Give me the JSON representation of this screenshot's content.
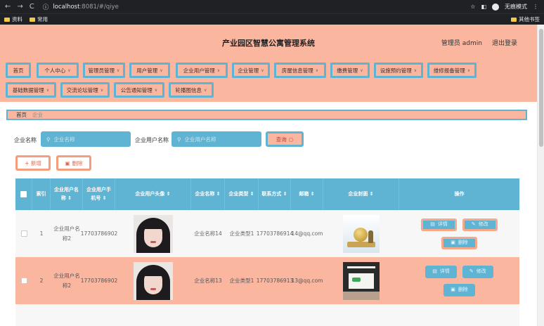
{
  "browser": {
    "url_host": "localhost",
    "url_path": ":8081/#/qiye",
    "incognito_label": "无痕模式",
    "bookmarks": [
      "资料",
      "常用"
    ],
    "other_bookmarks": "其他书签"
  },
  "header": {
    "title": "产业园区智慧公寓管理系统",
    "admin_label": "管理员 admin",
    "logout_label": "退出登录"
  },
  "menu": {
    "items": [
      {
        "label": "首页",
        "has_dropdown": false
      },
      {
        "label": "个人中心",
        "has_dropdown": true
      },
      {
        "label": "管理员管理",
        "has_dropdown": true
      },
      {
        "label": "用户管理",
        "has_dropdown": true
      },
      {
        "label": "企业用户管理",
        "has_dropdown": true
      },
      {
        "label": "企业管理",
        "has_dropdown": true
      },
      {
        "label": "房屋信息管理",
        "has_dropdown": true
      },
      {
        "label": "缴费管理",
        "has_dropdown": true
      },
      {
        "label": "设施预约管理",
        "has_dropdown": true
      },
      {
        "label": "维修报备管理",
        "has_dropdown": true
      },
      {
        "label": "基础数据管理",
        "has_dropdown": true
      },
      {
        "label": "交流论坛管理",
        "has_dropdown": true
      },
      {
        "label": "公告通知管理",
        "has_dropdown": true
      },
      {
        "label": "轮播图信息",
        "has_dropdown": true
      }
    ]
  },
  "breadcrumb": {
    "home": "首页",
    "current": "企业"
  },
  "search": {
    "company_label": "企业名称",
    "company_placeholder": "企业名称",
    "user_label": "企业用户名称",
    "user_placeholder": "企业用户名称",
    "query_button": "查询"
  },
  "actions": {
    "add": "+ 新增",
    "delete": "删除"
  },
  "table": {
    "columns": [
      "索引",
      "企业用户名称 ⇕",
      "企业用户手机号 ⇕",
      "企业用户头像 ⇕",
      "企业名称 ⇕",
      "企业类型 ⇕",
      "联系方式 ⇕",
      "邮箱 ⇕",
      "企业封面 ⇕",
      "操作"
    ],
    "rows": [
      {
        "index": "1",
        "user_name": "企业用户名称2",
        "phone": "17703786902",
        "company": "企业名称14",
        "type": "企业类型1",
        "contact": "17703786914",
        "email": "14@qq.com"
      },
      {
        "index": "2",
        "user_name": "企业用户名称2",
        "phone": "17703786902",
        "company": "企业名称13",
        "type": "企业类型1",
        "contact": "17703786913",
        "email": "13@qq.com"
      }
    ],
    "op_detail": "详情",
    "op_edit": "修改",
    "op_delete": "删除"
  },
  "colors": {
    "accent_blue": "#5fb3d3",
    "salmon": "#fbb6a0"
  }
}
